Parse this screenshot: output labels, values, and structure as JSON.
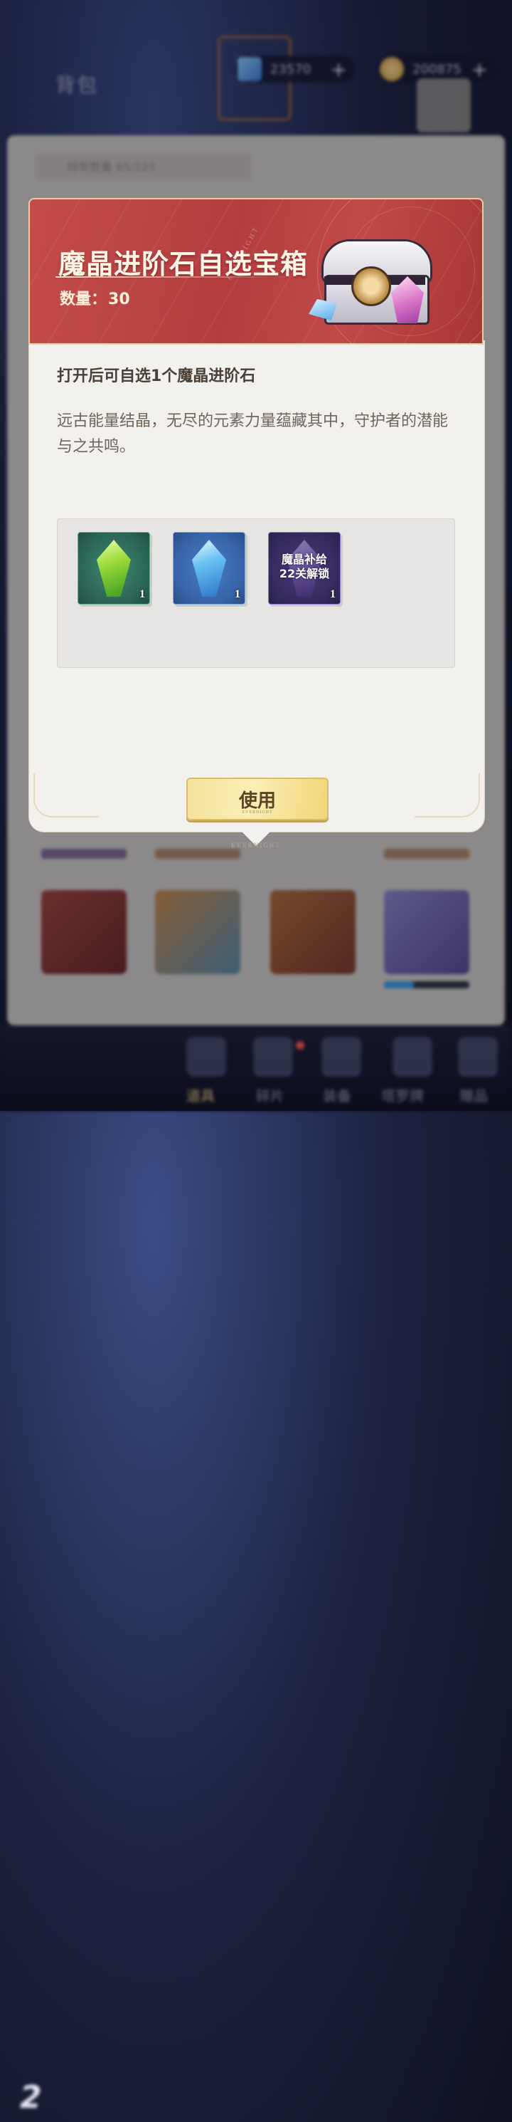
{
  "background": {
    "title": "背包",
    "currency1": "23570",
    "currency2": "200875",
    "capacity_label": "持有数量 65/225",
    "tabs": [
      "道具",
      "碎片",
      "装备",
      "塔罗牌",
      "赠品"
    ],
    "active_tab": "道具",
    "logo": "2"
  },
  "dialog": {
    "title": "魔晶进阶石自选宝箱",
    "quantity_label": "数量：",
    "quantity_value": "30",
    "brand_mark": "EVERNIGHT",
    "description_short": "打开后可自选1个魔晶进阶石",
    "description_long": "远古能量结晶，无尽的元素力量蕴藏其中，守护者的潜能与之共鸣。",
    "rewards": [
      {
        "name": "green-crystal",
        "count": "1"
      },
      {
        "name": "blue-crystal",
        "count": "1"
      },
      {
        "name": "locked-crystal",
        "count": "1",
        "lock_text_1": "魔晶补给",
        "lock_text_2": "22关解锁"
      }
    ],
    "use_button": "使用",
    "use_button_sub": "EVERNIGHT",
    "footer_mark": "EVERNIGHT"
  }
}
